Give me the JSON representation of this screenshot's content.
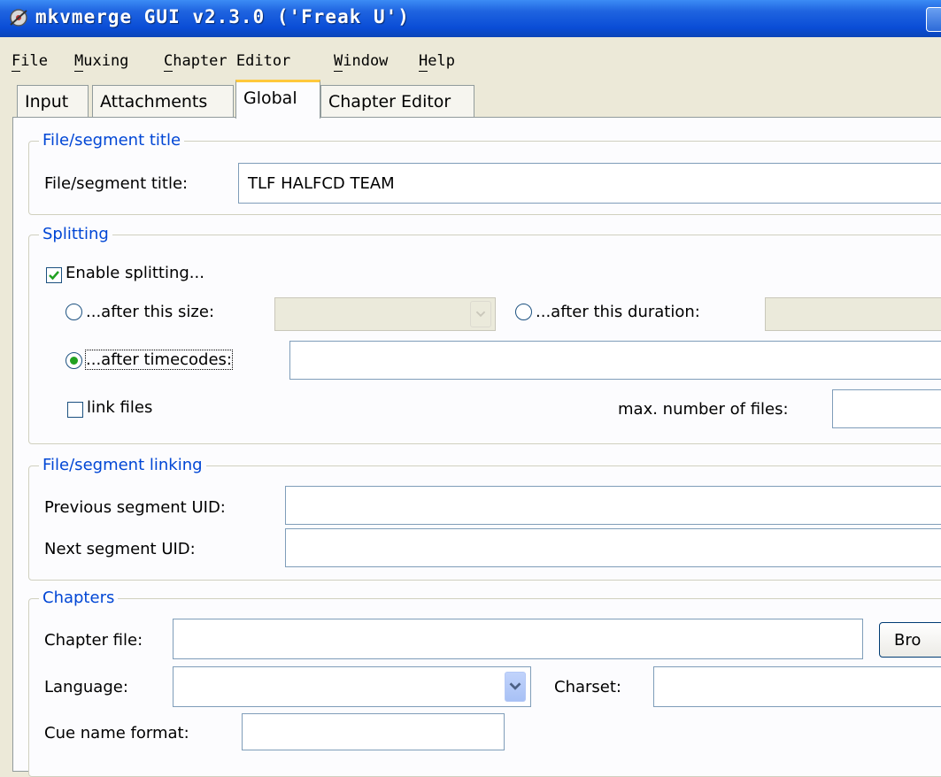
{
  "window": {
    "title": "mkvmerge GUI v2.3.0 ('Freak U')"
  },
  "menu": [
    "File",
    "Muxing",
    "Chapter Editor",
    "Window",
    "Help"
  ],
  "tabs": [
    "Input",
    "Attachments",
    "Global",
    "Chapter Editor"
  ],
  "active_tab": "Global",
  "file_segment_title": {
    "legend": "File/segment title",
    "label": "File/segment title:",
    "value": "TLF HALFCD TEAM"
  },
  "splitting": {
    "legend": "Splitting",
    "enable_label": "Enable splitting...",
    "enable_checked": true,
    "after_size_label": "...after this size:",
    "after_size_value": "",
    "after_duration_label": "...after this duration:",
    "after_duration_value": "",
    "after_timecodes_label": "...after timecodes:",
    "after_timecodes_value": "",
    "selected": "after timecodes",
    "link_files_label": "link files",
    "link_files_checked": false,
    "max_files_label": "max. number of files:",
    "max_files_value": ""
  },
  "linking": {
    "legend": "File/segment linking",
    "prev_label": "Previous segment UID:",
    "prev_value": "",
    "next_label": "Next segment UID:",
    "next_value": ""
  },
  "chapters": {
    "legend": "Chapters",
    "file_label": "Chapter file:",
    "file_value": "",
    "browse_label": "Bro",
    "language_label": "Language:",
    "language_value": "",
    "charset_label": "Charset:",
    "charset_value": "",
    "cue_label": "Cue name format:",
    "cue_value": ""
  },
  "colors": {
    "titlebar": "#0A4DD6",
    "legend_text": "#0046D5",
    "active_tab_accent": "#FFC83C",
    "checkbox_check": "#21A121"
  }
}
